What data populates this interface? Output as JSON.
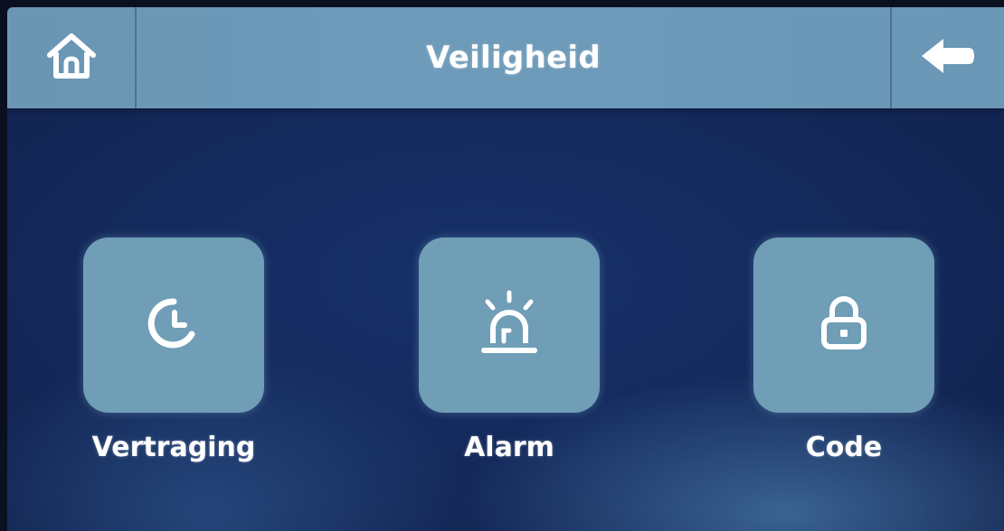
{
  "header": {
    "title": "Veiligheid",
    "home_icon": "home-icon",
    "back_icon": "arrow-left-icon"
  },
  "tiles": [
    {
      "label": "Vertraging",
      "icon": "clock-delay-icon"
    },
    {
      "label": "Alarm",
      "icon": "siren-icon"
    },
    {
      "label": "Code",
      "icon": "lock-icon"
    }
  ],
  "colors": {
    "topbar": "#6e9bba",
    "tile": "#6f9eb6",
    "background": "#142a5c",
    "text": "#ffffff"
  }
}
